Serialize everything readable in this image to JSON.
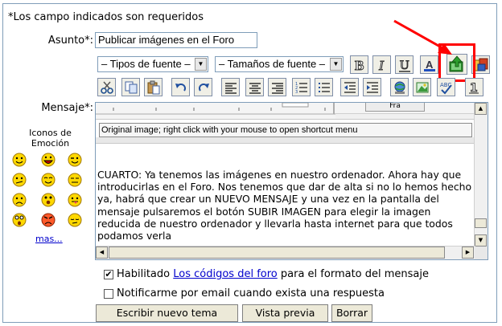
{
  "form": {
    "required_note": "*Los campo indicados son requeridos",
    "subject_label": "Asunto*:",
    "subject_value": "Publicar imágenes en el Foro",
    "message_label": "Mensaje*:"
  },
  "toolbar": {
    "font_type": "– Tipos de fuente –",
    "font_size": "– Tamaños de fuente –",
    "font_type_arrow": "▼",
    "font_size_arrow": "▼"
  },
  "editor": {
    "tooltip": "Original image; right click with your mouse to open shortcut menu",
    "ruler_button": "Fra",
    "content": "CUARTO: Ya tenemos las imágenes en nuestro ordenador. Ahora hay que introducirlas en el Foro. Nos tenemos que dar de alta si no lo hemos hecho ya, habrá que crear un NUEVO MENSAJE y una vez en la pantalla del mensaje pulsaremos el botón SUBIR IMAGEN para elegir la imagen reducida de nuestro ordenador y llevarla hasta internet para que todos podamos verla"
  },
  "emoticons": {
    "title": "Iconos de Emoción",
    "more": "mas..."
  },
  "options": {
    "enabled_prefix": "Habilitado",
    "forum_codes_link": "Los códigos del foro",
    "enabled_suffix": "para el formato del mensaje",
    "notify_label": "Notificarme por email cuando exista una respuesta",
    "enabled_check": "✔"
  },
  "buttons": {
    "new_topic": "Escribir nuevo tema",
    "preview": "Vista previa",
    "clear": "Borrar"
  }
}
